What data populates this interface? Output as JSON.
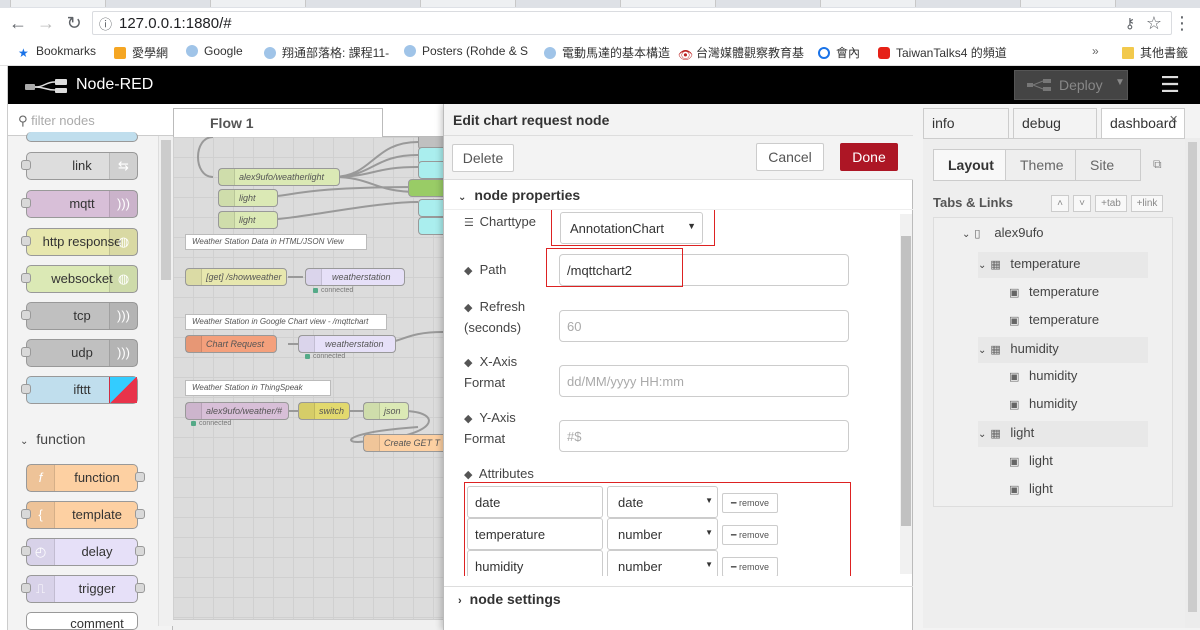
{
  "browser": {
    "url": "127.0.0.1:1880/#",
    "bookmarks": [
      {
        "label": "Bookmarks",
        "icon": "star-icon"
      },
      {
        "label": "愛學網",
        "icon": "page-icon"
      },
      {
        "label": "Google",
        "icon": "person-icon"
      },
      {
        "label": "翔通部落格: 課程11-",
        "icon": "person-icon"
      },
      {
        "label": "Posters (Rohde & S",
        "icon": "person-icon"
      },
      {
        "label": "電動馬達的基本構造",
        "icon": "person-icon"
      },
      {
        "label": "台灣媒體觀察教育基",
        "icon": "eye-icon"
      },
      {
        "label": "會內",
        "icon": "circle-icon"
      },
      {
        "label": "TaiwanTalks4 的頻道",
        "icon": "youtube-icon"
      }
    ],
    "other_bookmarks": "其他書籤"
  },
  "header": {
    "title": "Node-RED",
    "deploy_label": "Deploy"
  },
  "palette": {
    "search_placeholder": "filter nodes",
    "nodes": [
      {
        "label": "link",
        "color": "#dddddd"
      },
      {
        "label": "mqtt",
        "color": "#d8bfd8"
      },
      {
        "label": "http response",
        "color": "#e7e7ae"
      },
      {
        "label": "websocket",
        "color": "#dbe9b5"
      },
      {
        "label": "tcp",
        "color": "#c0c0c0"
      },
      {
        "label": "udp",
        "color": "#c0c0c0"
      },
      {
        "label": "ifttt",
        "color": "#c0deed"
      }
    ],
    "category": "function",
    "function_nodes": [
      {
        "label": "function",
        "color": "#fdd0a2"
      },
      {
        "label": "template",
        "color": "#fdd0a2"
      },
      {
        "label": "delay",
        "color": "#e6e0f8"
      },
      {
        "label": "trigger",
        "color": "#e6e0f8"
      },
      {
        "label": "comment",
        "color": "#ffffff"
      }
    ]
  },
  "workspace": {
    "tab": "Flow 1",
    "flow_nodes": [
      "alex9ufo/weatherlight",
      "light",
      "light",
      "[get] /showweather",
      "weatherstation",
      "Chart Request",
      "weatherstation",
      "alex9ufo/weather/#",
      "switch",
      "json",
      "Create GET T"
    ],
    "comments": [
      "Weather Station Data in HTML/JSON View",
      "Weather Station in Google Chart view - /mqttchart",
      "Weather Station in ThingSpeak"
    ],
    "status_connected": "connected"
  },
  "tray": {
    "title": "Edit chart request node",
    "delete_label": "Delete",
    "cancel_label": "Cancel",
    "done_label": "Done",
    "section_props": "node properties",
    "section_settings": "node settings",
    "charttype_label": "Charttype",
    "charttype_value": "AnnotationChart",
    "path_label": "Path",
    "path_value": "/mqttchart2",
    "refresh_label_1": "Refresh",
    "refresh_label_2": "(seconds)",
    "refresh_placeholder": "60",
    "xaxis_label_1": "X-Axis",
    "xaxis_label_2": "Format",
    "xaxis_placeholder": "dd/MM/yyyy HH:mm",
    "yaxis_label_1": "Y-Axis",
    "yaxis_label_2": "Format",
    "yaxis_placeholder": "#$",
    "attributes_label": "Attributes",
    "attributes": [
      {
        "name": "date",
        "type": "date"
      },
      {
        "name": "temperature",
        "type": "number"
      },
      {
        "name": "humidity",
        "type": "number"
      }
    ],
    "remove_label": "remove"
  },
  "sidebar": {
    "tabs": [
      "info",
      "debug",
      "dashboard"
    ],
    "dash_tabs": [
      "Layout",
      "Theme",
      "Site"
    ],
    "tabs_links_label": "Tabs & Links",
    "add_tab": "tab",
    "add_link": "link",
    "tree": {
      "tab": "alex9ufo",
      "groups": [
        {
          "name": "temperature",
          "items": [
            "temperature",
            "temperature"
          ]
        },
        {
          "name": "humidity",
          "items": [
            "humidity",
            "humidity"
          ]
        },
        {
          "name": "light",
          "items": [
            "light",
            "light"
          ]
        }
      ]
    }
  }
}
